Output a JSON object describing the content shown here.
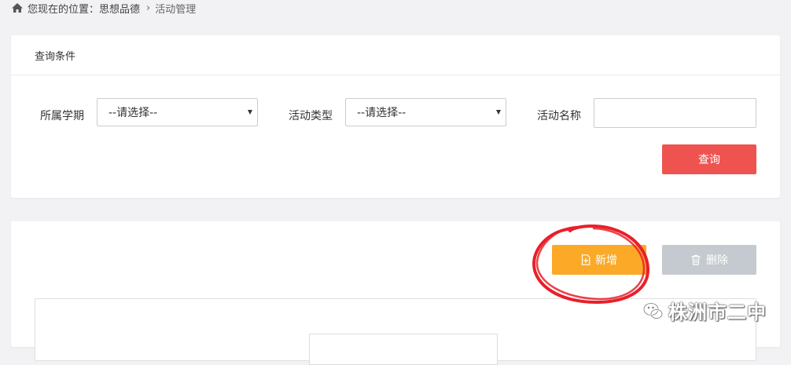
{
  "breadcrumb": {
    "prefix": "您现在的位置：",
    "parent": "思想品德",
    "current": "活动管理"
  },
  "query_panel": {
    "title": "查询条件",
    "fields": {
      "semester_label": "所属学期",
      "semester_value": "--请选择--",
      "type_label": "活动类型",
      "type_value": "--请选择--",
      "name_label": "活动名称",
      "name_value": ""
    },
    "query_button": "查询"
  },
  "list_panel": {
    "add_button": "新增",
    "delete_button": "删除"
  },
  "watermark": {
    "text": "株洲市二中"
  },
  "colors": {
    "query_button": "#ef5350",
    "add_button": "#fba927",
    "delete_button": "#c4cacf",
    "annotation": "#e8202a"
  }
}
